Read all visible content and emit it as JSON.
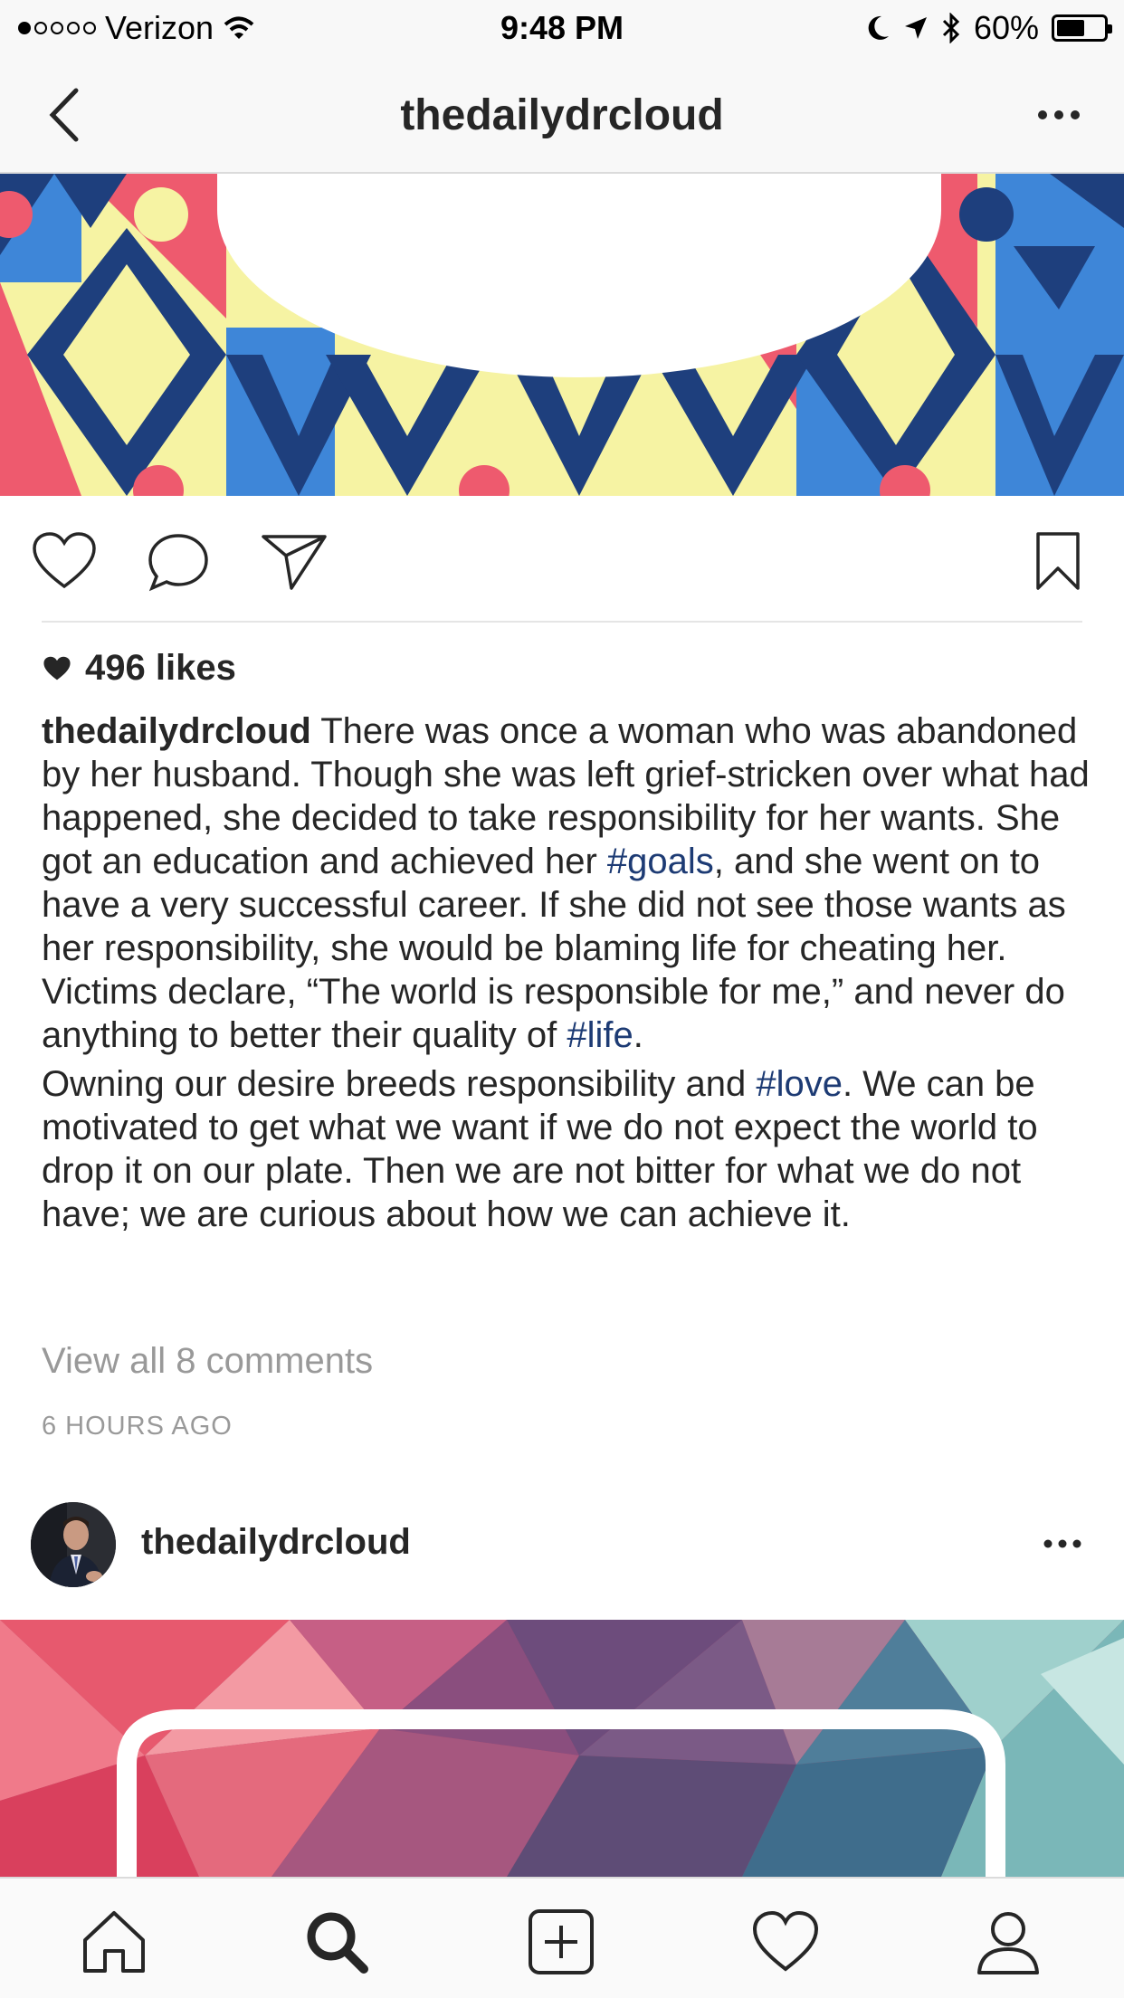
{
  "status": {
    "carrier": "Verizon",
    "time": "9:48 PM",
    "battery": "60%",
    "battery_level": 0.6
  },
  "nav": {
    "title": "thedailydrcloud"
  },
  "post": {
    "likes": "496 likes",
    "username": "thedailydrcloud",
    "caption_p1": [
      " There was once a woman who was abandoned by her husband. Though she was left grief-stricken over what had happened, she decided to take responsibility for her wants. She got an education and achieved her ",
      "#goals",
      ", and she went on to have a very successful career. If she did not see those wants as her responsibility, she would be blaming life for cheating her. Victims declare, “The world is responsible for me,” and never do anything to better their quality of ",
      "#life",
      "."
    ],
    "caption_p2": [
      "Owning our desire breeds responsibility and ",
      "#love",
      ". We can be motivated to get what we want if we do not expect the world to drop it on our plate. Then we are not bitter for what we do not have; we are curious about how we can achieve it."
    ],
    "view_comments": "View all 8 comments",
    "timestamp": "6 HOURS AGO"
  },
  "next_post": {
    "username": "thedailydrcloud"
  },
  "colors": {
    "hashtag": "#1d3b74",
    "muted": "#999999",
    "banner_navy": "#1e3f7d",
    "banner_red": "#ee5a6e",
    "banner_yellow": "#f6f3a3",
    "banner_blue": "#3e86d8"
  },
  "icons": {
    "actions": [
      "heart-icon",
      "comment-icon",
      "share-icon",
      "bookmark-icon"
    ],
    "tabbar": [
      "home-icon",
      "search-icon",
      "add-icon",
      "activity-heart-icon",
      "profile-icon"
    ]
  }
}
